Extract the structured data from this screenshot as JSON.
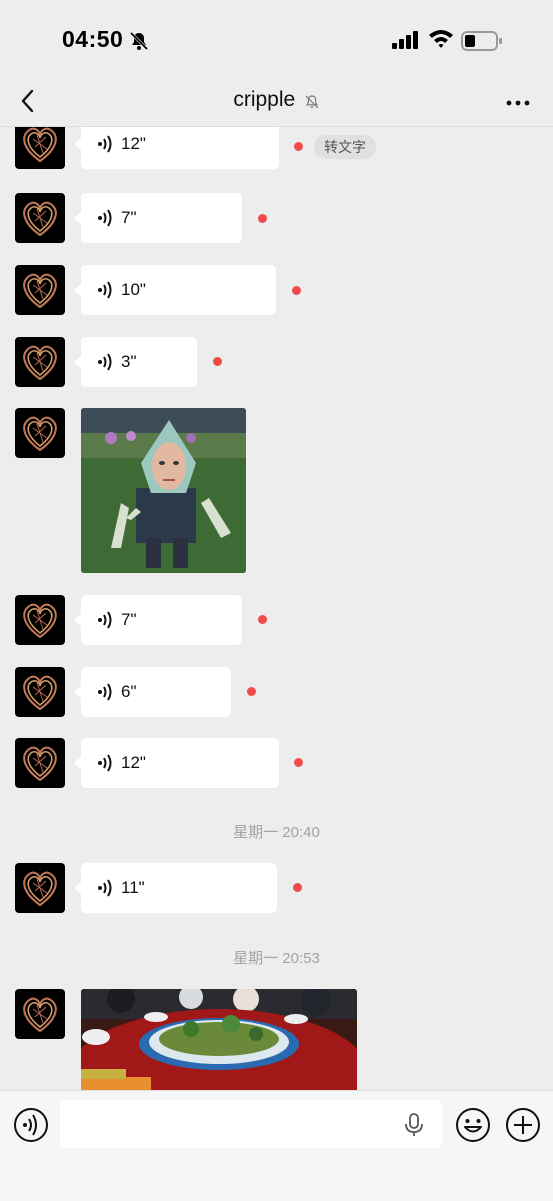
{
  "status_bar": {
    "time": "04:50",
    "icons": [
      "bell-off-icon",
      "signal-icon",
      "wifi-icon",
      "battery-icon"
    ]
  },
  "nav": {
    "title": "cripple",
    "back_icon": "chevron-left-icon",
    "mute_icon": "bell-off-icon",
    "more_icon": "ellipsis-icon"
  },
  "messages": [
    {
      "type": "voice",
      "duration": "12\"",
      "unread": true,
      "transcribe_label": "转文字"
    },
    {
      "type": "voice",
      "duration": "7\"",
      "unread": true
    },
    {
      "type": "voice",
      "duration": "10\"",
      "unread": true
    },
    {
      "type": "voice",
      "duration": "3\"",
      "unread": true
    },
    {
      "type": "image",
      "description_icon": "photo"
    },
    {
      "type": "voice",
      "duration": "7\"",
      "unread": true
    },
    {
      "type": "voice",
      "duration": "6\"",
      "unread": true
    },
    {
      "type": "voice",
      "duration": "12\"",
      "unread": true
    },
    {
      "type": "timestamp",
      "text": "星期一 20:40"
    },
    {
      "type": "voice",
      "duration": "11\"",
      "unread": true
    },
    {
      "type": "timestamp",
      "text": "星期一 20:53"
    },
    {
      "type": "image",
      "description_icon": "photo"
    }
  ],
  "input_bar": {
    "voice_icon": "voice-mode-icon",
    "mic_icon": "mic-icon",
    "emoji_icon": "emoji-icon",
    "plus_icon": "plus-icon",
    "value": ""
  },
  "colors": {
    "background": "#ededed",
    "bubble": "#ffffff",
    "unread_dot": "#f04a4a",
    "timestamp_text": "#a3a3a3"
  }
}
